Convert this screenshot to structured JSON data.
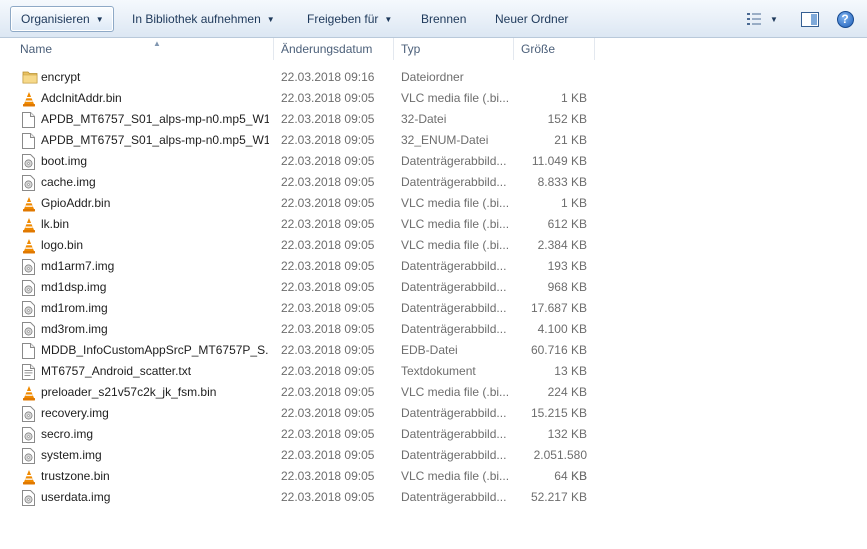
{
  "toolbar": {
    "organize": "Organisieren",
    "add_to_library": "In Bibliothek aufnehmen",
    "share_with": "Freigeben für",
    "burn": "Brennen",
    "new_folder": "Neuer Ordner"
  },
  "columns": {
    "name": "Name",
    "date": "Änderungsdatum",
    "type": "Typ",
    "size": "Größe"
  },
  "files": [
    {
      "name": "encrypt",
      "date": "22.03.2018 09:16",
      "type": "Dateiordner",
      "size": "",
      "icon": "folder-icon"
    },
    {
      "name": "AdcInitAddr.bin",
      "date": "22.03.2018 09:05",
      "type": "VLC media file (.bi...",
      "size": "1 KB",
      "icon": "vlc-icon"
    },
    {
      "name": "APDB_MT6757_S01_alps-mp-n0.mp5_W1...",
      "date": "22.03.2018 09:05",
      "type": "32-Datei",
      "size": "152 KB",
      "icon": "file-icon"
    },
    {
      "name": "APDB_MT6757_S01_alps-mp-n0.mp5_W1...",
      "date": "22.03.2018 09:05",
      "type": "32_ENUM-Datei",
      "size": "21 KB",
      "icon": "file-icon"
    },
    {
      "name": "boot.img",
      "date": "22.03.2018 09:05",
      "type": "Datenträgerabbild...",
      "size": "11.049 KB",
      "icon": "disc-image-icon"
    },
    {
      "name": "cache.img",
      "date": "22.03.2018 09:05",
      "type": "Datenträgerabbild...",
      "size": "8.833 KB",
      "icon": "disc-image-icon"
    },
    {
      "name": "GpioAddr.bin",
      "date": "22.03.2018 09:05",
      "type": "VLC media file (.bi...",
      "size": "1 KB",
      "icon": "vlc-icon"
    },
    {
      "name": "lk.bin",
      "date": "22.03.2018 09:05",
      "type": "VLC media file (.bi...",
      "size": "612 KB",
      "icon": "vlc-icon"
    },
    {
      "name": "logo.bin",
      "date": "22.03.2018 09:05",
      "type": "VLC media file (.bi...",
      "size": "2.384 KB",
      "icon": "vlc-icon"
    },
    {
      "name": "md1arm7.img",
      "date": "22.03.2018 09:05",
      "type": "Datenträgerabbild...",
      "size": "193 KB",
      "icon": "disc-image-icon"
    },
    {
      "name": "md1dsp.img",
      "date": "22.03.2018 09:05",
      "type": "Datenträgerabbild...",
      "size": "968 KB",
      "icon": "disc-image-icon"
    },
    {
      "name": "md1rom.img",
      "date": "22.03.2018 09:05",
      "type": "Datenträgerabbild...",
      "size": "17.687 KB",
      "icon": "disc-image-icon"
    },
    {
      "name": "md3rom.img",
      "date": "22.03.2018 09:05",
      "type": "Datenträgerabbild...",
      "size": "4.100 KB",
      "icon": "disc-image-icon"
    },
    {
      "name": "MDDB_InfoCustomAppSrcP_MT6757P_S...",
      "date": "22.03.2018 09:05",
      "type": "EDB-Datei",
      "size": "60.716 KB",
      "icon": "file-icon"
    },
    {
      "name": "MT6757_Android_scatter.txt",
      "date": "22.03.2018 09:05",
      "type": "Textdokument",
      "size": "13 KB",
      "icon": "text-file-icon"
    },
    {
      "name": "preloader_s21v57c2k_jk_fsm.bin",
      "date": "22.03.2018 09:05",
      "type": "VLC media file (.bi...",
      "size": "224 KB",
      "icon": "vlc-icon"
    },
    {
      "name": "recovery.img",
      "date": "22.03.2018 09:05",
      "type": "Datenträgerabbild...",
      "size": "15.215 KB",
      "icon": "disc-image-icon"
    },
    {
      "name": "secro.img",
      "date": "22.03.2018 09:05",
      "type": "Datenträgerabbild...",
      "size": "132 KB",
      "icon": "disc-image-icon"
    },
    {
      "name": "system.img",
      "date": "22.03.2018 09:05",
      "type": "Datenträgerabbild...",
      "size": "2.051.580 KB",
      "icon": "disc-image-icon"
    },
    {
      "name": "trustzone.bin",
      "date": "22.03.2018 09:05",
      "type": "VLC media file (.bi...",
      "size": "64 KB",
      "icon": "vlc-icon"
    },
    {
      "name": "userdata.img",
      "date": "22.03.2018 09:05",
      "type": "Datenträgerabbild...",
      "size": "52.217 KB",
      "icon": "disc-image-icon"
    }
  ],
  "colors": {
    "toolbar_text": "#1e395b",
    "header_text": "#4c607a",
    "detail_text": "#6d6d6d",
    "folder": "#e8c163",
    "vlc_orange": "#f08a00"
  }
}
